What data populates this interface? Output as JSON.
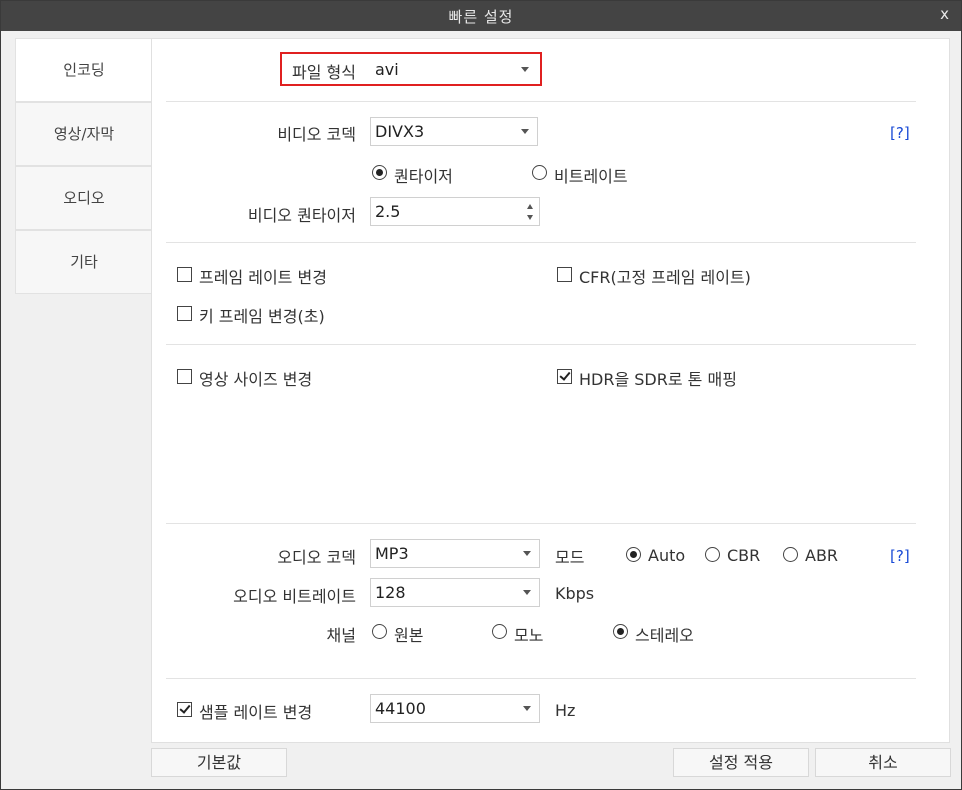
{
  "window": {
    "title": "빠른 설정",
    "close_label": "x"
  },
  "sidebar": {
    "items": [
      {
        "label": "인코딩",
        "active": true
      },
      {
        "label": "영상/자막",
        "active": false
      },
      {
        "label": "오디오",
        "active": false
      },
      {
        "label": "기타",
        "active": false
      }
    ]
  },
  "file_format": {
    "label": "파일 형식",
    "value": "avi"
  },
  "video": {
    "codec_label": "비디오 코덱",
    "codec_value": "DIVX3",
    "help": "[?]",
    "mode_quantizer": "퀀타이저",
    "mode_bitrate": "비트레이트",
    "selected_mode": "퀀타이저",
    "quantizer_label": "비디오 퀀타이저",
    "quantizer_value": "2.5"
  },
  "frame": {
    "change_fps": {
      "label": "프레임 레이트 변경",
      "checked": false
    },
    "cfr": {
      "label": "CFR(고정 프레임 레이트)",
      "checked": false
    },
    "keyframe": {
      "label": "키 프레임 변경(초)",
      "checked": false
    }
  },
  "size": {
    "resize": {
      "label": "영상 사이즈 변경",
      "checked": false
    },
    "hdr_to_sdr": {
      "label": "HDR을 SDR로 톤 매핑",
      "checked": true
    }
  },
  "audio": {
    "codec_label": "오디오 코덱",
    "codec_value": "MP3",
    "mode_label": "모드",
    "modes": [
      "Auto",
      "CBR",
      "ABR"
    ],
    "selected_mode": "Auto",
    "help": "[?]",
    "bitrate_label": "오디오 비트레이트",
    "bitrate_value": "128",
    "bitrate_unit": "Kbps",
    "channel_label": "채널",
    "channels": [
      "원본",
      "모노",
      "스테레오"
    ],
    "selected_channel": "스테레오",
    "samplerate": {
      "label": "샘플 레이트 변경",
      "checked": true
    },
    "samplerate_value": "44100",
    "samplerate_unit": "Hz"
  },
  "buttons": {
    "default": "기본값",
    "apply": "설정 적용",
    "cancel": "취소"
  },
  "colors": {
    "titlebar": "#444444",
    "highlight": "#e02020",
    "help_link": "#1a4bd6"
  }
}
